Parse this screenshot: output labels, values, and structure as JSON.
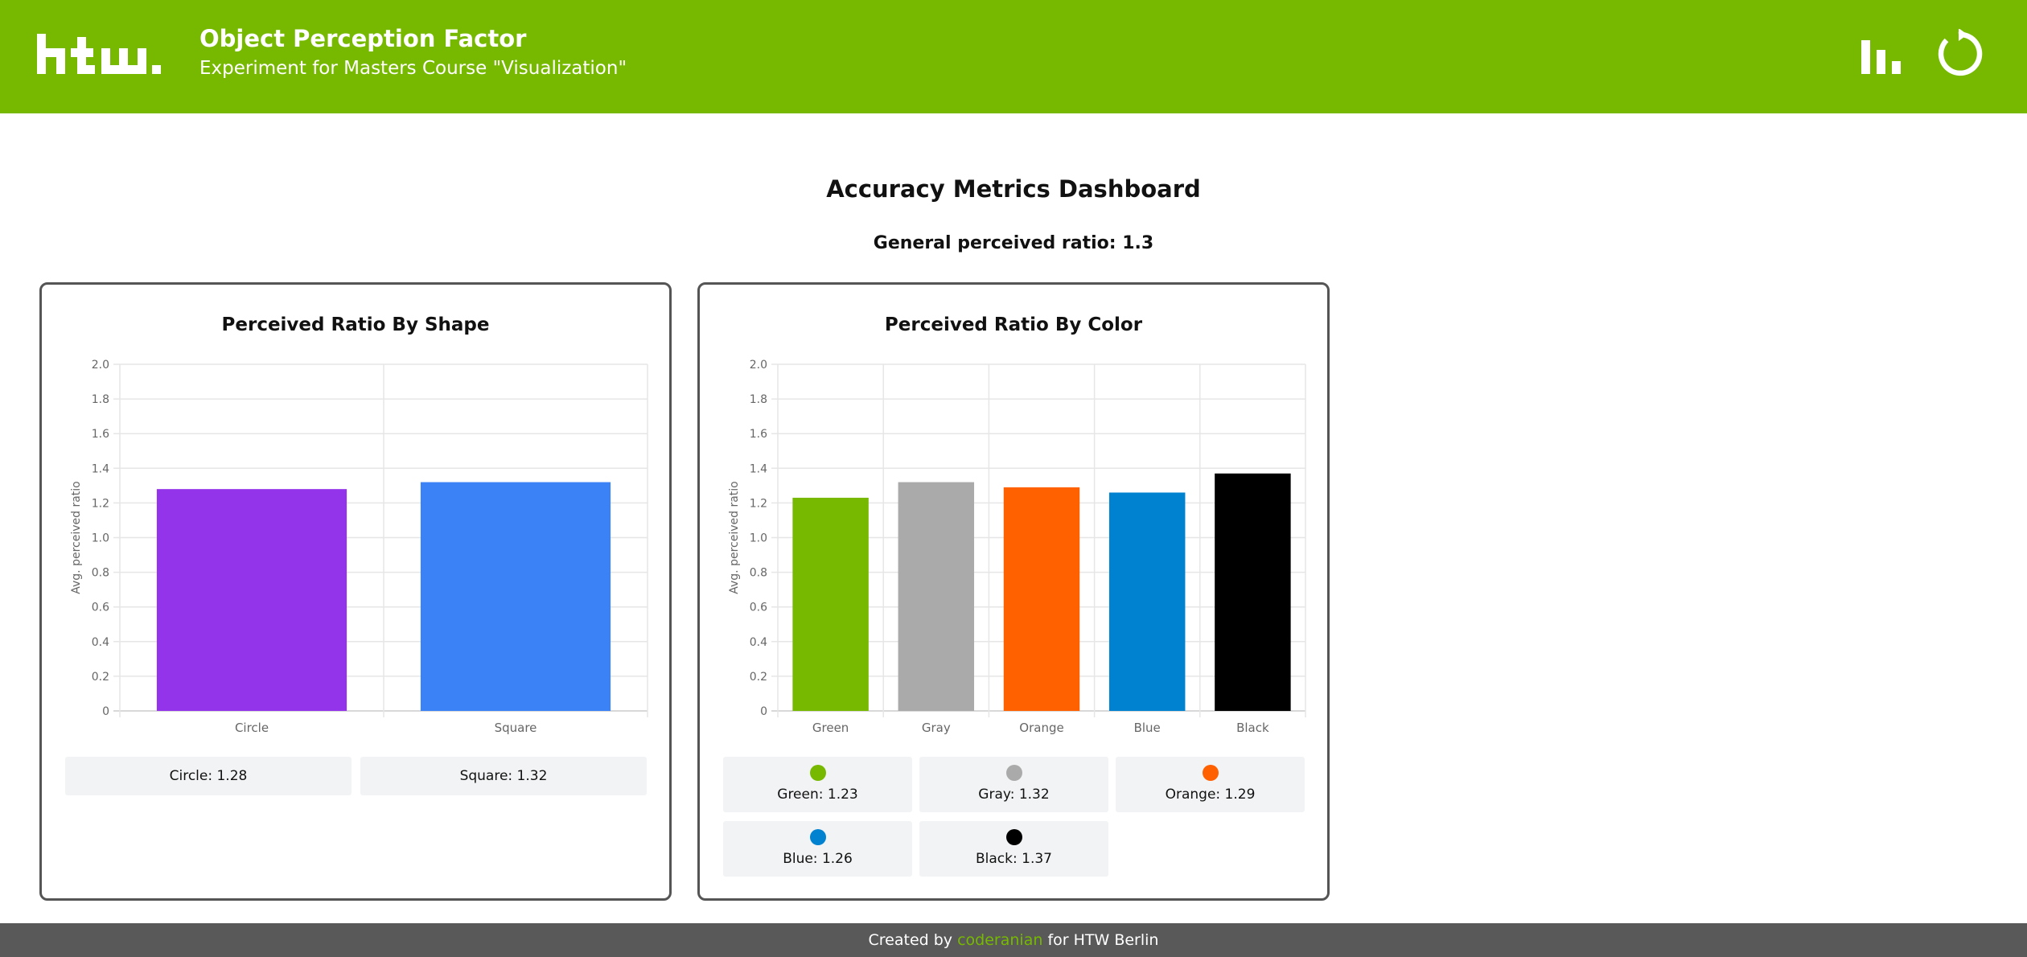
{
  "header": {
    "logo_text": "htw.",
    "title": "Object Perception Factor",
    "subtitle": "Experiment for Masters Course \"Visualization\""
  },
  "icons": {
    "stats": "bar-chart-icon",
    "reset": "refresh-icon"
  },
  "dashboard": {
    "title": "Accuracy Metrics Dashboard",
    "general_label": "General perceived ratio: 1.3"
  },
  "chart_data": [
    {
      "type": "bar",
      "title": "Perceived Ratio By Shape",
      "ylabel": "Avg. perceived ratio",
      "xlabel": "",
      "ylim": [
        0,
        2.0
      ],
      "yticks": [
        "0",
        "0.2",
        "0.4",
        "0.6",
        "0.8",
        "1.0",
        "1.2",
        "1.4",
        "1.6",
        "1.8",
        "2.0"
      ],
      "grid": true,
      "categories": [
        "Circle",
        "Square"
      ],
      "values": [
        1.28,
        1.32
      ],
      "colors": [
        "#9333ea",
        "#3b82f6"
      ],
      "legend": [
        {
          "label": "Circle: 1.28"
        },
        {
          "label": "Square: 1.32"
        }
      ]
    },
    {
      "type": "bar",
      "title": "Perceived Ratio By Color",
      "ylabel": "Avg. perceived ratio",
      "xlabel": "",
      "ylim": [
        0,
        2.0
      ],
      "yticks": [
        "0",
        "0.2",
        "0.4",
        "0.6",
        "0.8",
        "1.0",
        "1.2",
        "1.4",
        "1.6",
        "1.8",
        "2.0"
      ],
      "grid": true,
      "categories": [
        "Green",
        "Gray",
        "Orange",
        "Blue",
        "Black"
      ],
      "values": [
        1.23,
        1.32,
        1.29,
        1.26,
        1.37
      ],
      "colors": [
        "#76b900",
        "#aaaaaa",
        "#ff6000",
        "#0082d1",
        "#000000"
      ],
      "legend": [
        {
          "label": "Green: 1.23"
        },
        {
          "label": "Gray: 1.32"
        },
        {
          "label": "Orange: 1.29"
        },
        {
          "label": "Blue: 1.26"
        },
        {
          "label": "Black: 1.37"
        }
      ]
    }
  ],
  "footer": {
    "prefix": "Created by",
    "link": "coderanian",
    "suffix": "for HTW Berlin"
  },
  "colors": {
    "brand": "#76b900",
    "footer": "#595959"
  }
}
